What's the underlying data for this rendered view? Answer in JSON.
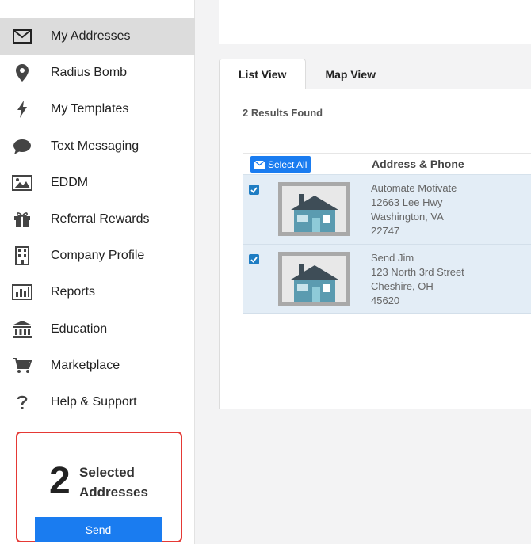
{
  "sidebar": {
    "items": [
      {
        "label": "My Addresses",
        "icon": "envelope-icon"
      },
      {
        "label": "Radius Bomb",
        "icon": "map-pin-icon"
      },
      {
        "label": "My Templates",
        "icon": "lightning-icon"
      },
      {
        "label": "Text Messaging",
        "icon": "chat-bubble-icon"
      },
      {
        "label": "EDDM",
        "icon": "image-icon"
      },
      {
        "label": "Referral Rewards",
        "icon": "gift-icon"
      },
      {
        "label": "Company Profile",
        "icon": "building-icon"
      },
      {
        "label": "Reports",
        "icon": "bar-chart-icon"
      },
      {
        "label": "Education",
        "icon": "institution-icon"
      },
      {
        "label": "Marketplace",
        "icon": "cart-icon"
      },
      {
        "label": "Help & Support",
        "icon": "question-icon"
      }
    ],
    "active_index": 0
  },
  "selection": {
    "count": "2",
    "line1": "Selected",
    "line2": "Addresses",
    "send_label": "Send"
  },
  "tabs": [
    {
      "label": "List View",
      "active": true
    },
    {
      "label": "Map View",
      "active": false
    }
  ],
  "results_text": "2 Results Found",
  "table": {
    "select_all_label": "Select All",
    "address_header": "Address & Phone",
    "rows": [
      {
        "name": "Automate Motivate",
        "street": "12663 Lee Hwy",
        "city_state": "Washington, VA",
        "zip": "22747",
        "checked": true
      },
      {
        "name": "Send Jim",
        "street": "123 North 3rd Street",
        "city_state": "Cheshire, OH",
        "zip": "45620",
        "checked": true
      }
    ]
  },
  "colors": {
    "accent": "#1a7cf0",
    "row_bg": "#e3edf6",
    "highlight_border": "#e53935"
  }
}
